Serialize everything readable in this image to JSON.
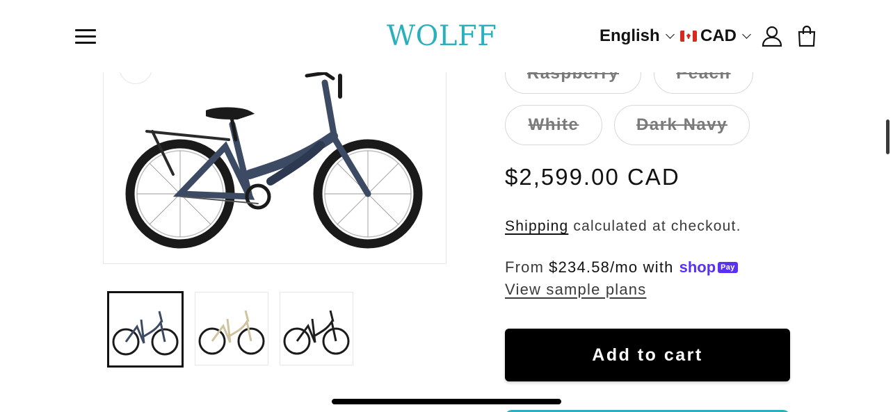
{
  "header": {
    "logo": "WOLFF",
    "language": "English",
    "currency": "CAD"
  },
  "variants": {
    "row1": [
      "Raspberry",
      "Peach"
    ],
    "row2": [
      "White",
      "Dark Navy"
    ]
  },
  "product": {
    "price": "$2,599.00 CAD",
    "shipping_link": "Shipping",
    "shipping_text": " calculated at checkout.",
    "installment_prefix": "From",
    "installment_amount": "$234.58/mo with",
    "shoppay_label": "shop",
    "shoppay_badge": "Pay",
    "view_plans": "View sample plans",
    "add_to_cart": "Add to cart"
  },
  "gallery": {
    "thumbnail_colors": [
      "#3c4a63",
      "#cfc3a0",
      "#1e1e1e"
    ]
  },
  "colors": {
    "brand": "#2ab0bd",
    "shoppay": "#5a31f4",
    "frame_navy": "#3c4a63"
  }
}
